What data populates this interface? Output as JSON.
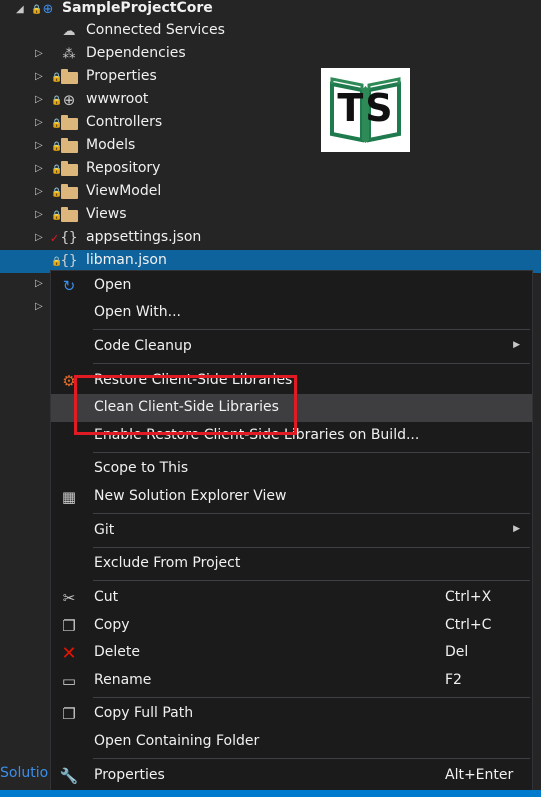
{
  "tree": {
    "root_label": "SampleProjectCore",
    "items": [
      {
        "label": "Connected Services"
      },
      {
        "label": "Dependencies"
      },
      {
        "label": "Properties"
      },
      {
        "label": "wwwroot"
      },
      {
        "label": "Controllers"
      },
      {
        "label": "Models"
      },
      {
        "label": "Repository"
      },
      {
        "label": "ViewModel"
      },
      {
        "label": "Views"
      },
      {
        "label": "appsettings.json"
      },
      {
        "label": "libman.json"
      }
    ]
  },
  "logo": {
    "text": "TS"
  },
  "bottom_tab": {
    "label": "Solutio"
  },
  "context_menu": {
    "items": [
      {
        "label": "Open",
        "icon": "open-refresh-icon"
      },
      {
        "label": "Open With..."
      },
      {
        "label": "Code Cleanup",
        "submenu": true
      },
      {
        "label": "Restore Client-Side Libraries",
        "icon": "restore-libraries-icon"
      },
      {
        "label": "Clean Client-Side Libraries"
      },
      {
        "label": "Enable Restore Client-Side Libraries on Build..."
      },
      {
        "label": "Scope to This"
      },
      {
        "label": "New Solution Explorer View",
        "icon": "solution-explorer-icon"
      },
      {
        "label": "Git",
        "submenu": true
      },
      {
        "label": "Exclude From Project"
      },
      {
        "label": "Cut",
        "shortcut": "Ctrl+X",
        "icon": "scissors-icon"
      },
      {
        "label": "Copy",
        "shortcut": "Ctrl+C",
        "icon": "copy-icon"
      },
      {
        "label": "Delete",
        "shortcut": "Del",
        "icon": "delete-x-icon"
      },
      {
        "label": "Rename",
        "shortcut": "F2",
        "icon": "rename-icon"
      },
      {
        "label": "Copy Full Path",
        "icon": "copy-path-icon"
      },
      {
        "label": "Open Containing Folder"
      },
      {
        "label": "Properties",
        "shortcut": "Alt+Enter",
        "icon": "wrench-icon"
      }
    ]
  },
  "colors": {
    "background": "#252526",
    "selection": "#0e639c",
    "menu_background": "#1b1b1c",
    "highlight_box": "#e01b24",
    "logo_green": "#2e8b57",
    "folder": "#dcb67a"
  }
}
